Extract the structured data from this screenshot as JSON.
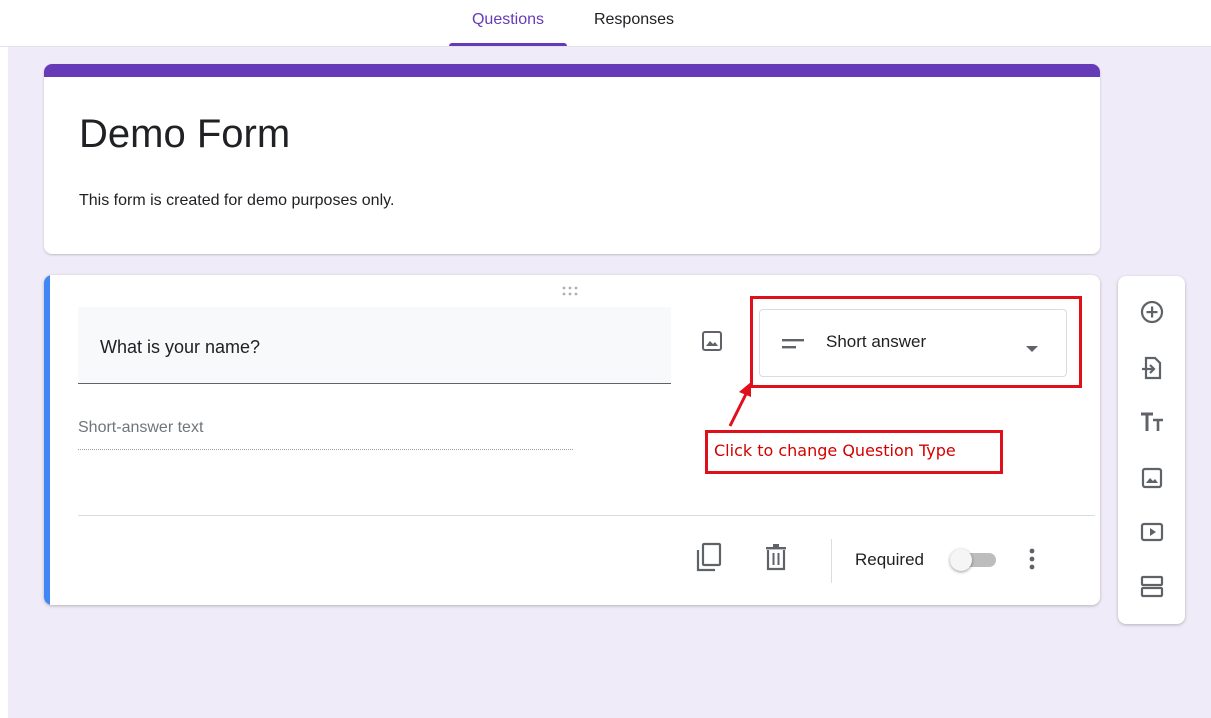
{
  "tabs": [
    {
      "label": "Questions",
      "active": true
    },
    {
      "label": "Responses",
      "active": false
    }
  ],
  "form": {
    "title": "Demo Form",
    "description": "This form is created for demo purposes only."
  },
  "question": {
    "title": "What is your name?",
    "type_label": "Short answer",
    "answer_placeholder": "Short-answer text",
    "required_label": "Required",
    "required": false
  },
  "annotation": {
    "text": "Click to change Question Type",
    "color": "#e0101a"
  },
  "colors": {
    "accent": "#673ab7",
    "active_question_bar": "#4285f4",
    "canvas": "#f0ebf8"
  },
  "toolbar_icons": [
    "add-question-icon",
    "import-questions-icon",
    "add-title-icon",
    "add-image-icon",
    "add-video-icon",
    "add-section-icon"
  ],
  "footer_icons": [
    "duplicate-icon",
    "delete-icon",
    "more-options-icon"
  ]
}
